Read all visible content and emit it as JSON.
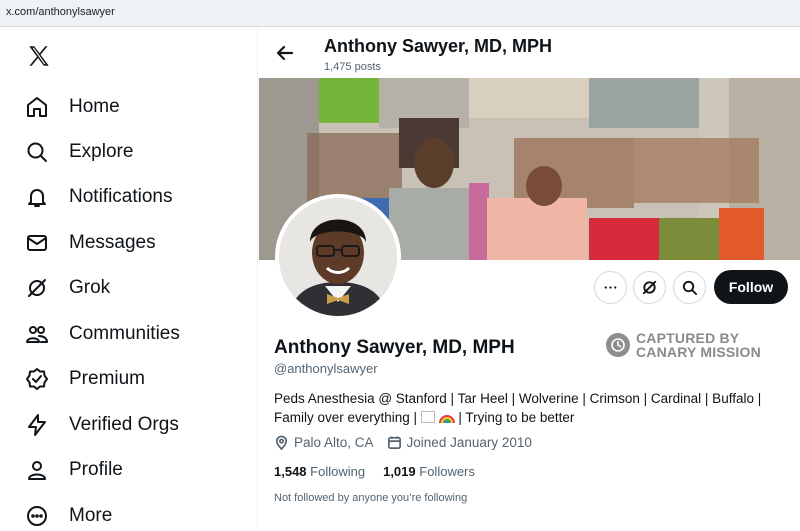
{
  "browser": {
    "url": "x.com/anthonylsawyer"
  },
  "sidebar": {
    "logo_icon": "x-logo-icon",
    "items": [
      {
        "label": "Home",
        "icon": "home-icon"
      },
      {
        "label": "Explore",
        "icon": "search-icon"
      },
      {
        "label": "Notifications",
        "icon": "bell-icon"
      },
      {
        "label": "Messages",
        "icon": "envelope-icon"
      },
      {
        "label": "Grok",
        "icon": "grok-icon"
      },
      {
        "label": "Communities",
        "icon": "people-icon"
      },
      {
        "label": "Premium",
        "icon": "verified-badge-icon"
      },
      {
        "label": "Verified Orgs",
        "icon": "lightning-icon"
      },
      {
        "label": "Profile",
        "icon": "person-icon"
      },
      {
        "label": "More",
        "icon": "more-circle-icon"
      }
    ]
  },
  "header": {
    "name": "Anthony Sawyer, MD, MPH",
    "posts": "1,475 posts"
  },
  "profile": {
    "name": "Anthony Sawyer, MD, MPH",
    "handle": "@anthonylsawyer",
    "bio_line1": "Peds Anesthesia @ Stanford | Tar Heel | Wolverine | Crimson | Cardinal | Buffalo |",
    "bio_line2_start": "Family over everything |",
    "bio_line2_end": "| Trying to be better",
    "location": "Palo Alto, CA",
    "joined": "Joined January 2010",
    "following_count": "1,548",
    "following_label": "Following",
    "followers_count": "1,019",
    "followers_label": "Followers",
    "not_followed": "Not followed by anyone you’re following"
  },
  "actions": {
    "follow_label": "Follow"
  },
  "watermark": {
    "line1": "CAPTURED BY",
    "line2": "CANARY MISSION"
  },
  "colors": {
    "text": "#0f1419",
    "muted": "#536471",
    "border": "#cfd9de",
    "follow_bg": "#0f1419"
  }
}
